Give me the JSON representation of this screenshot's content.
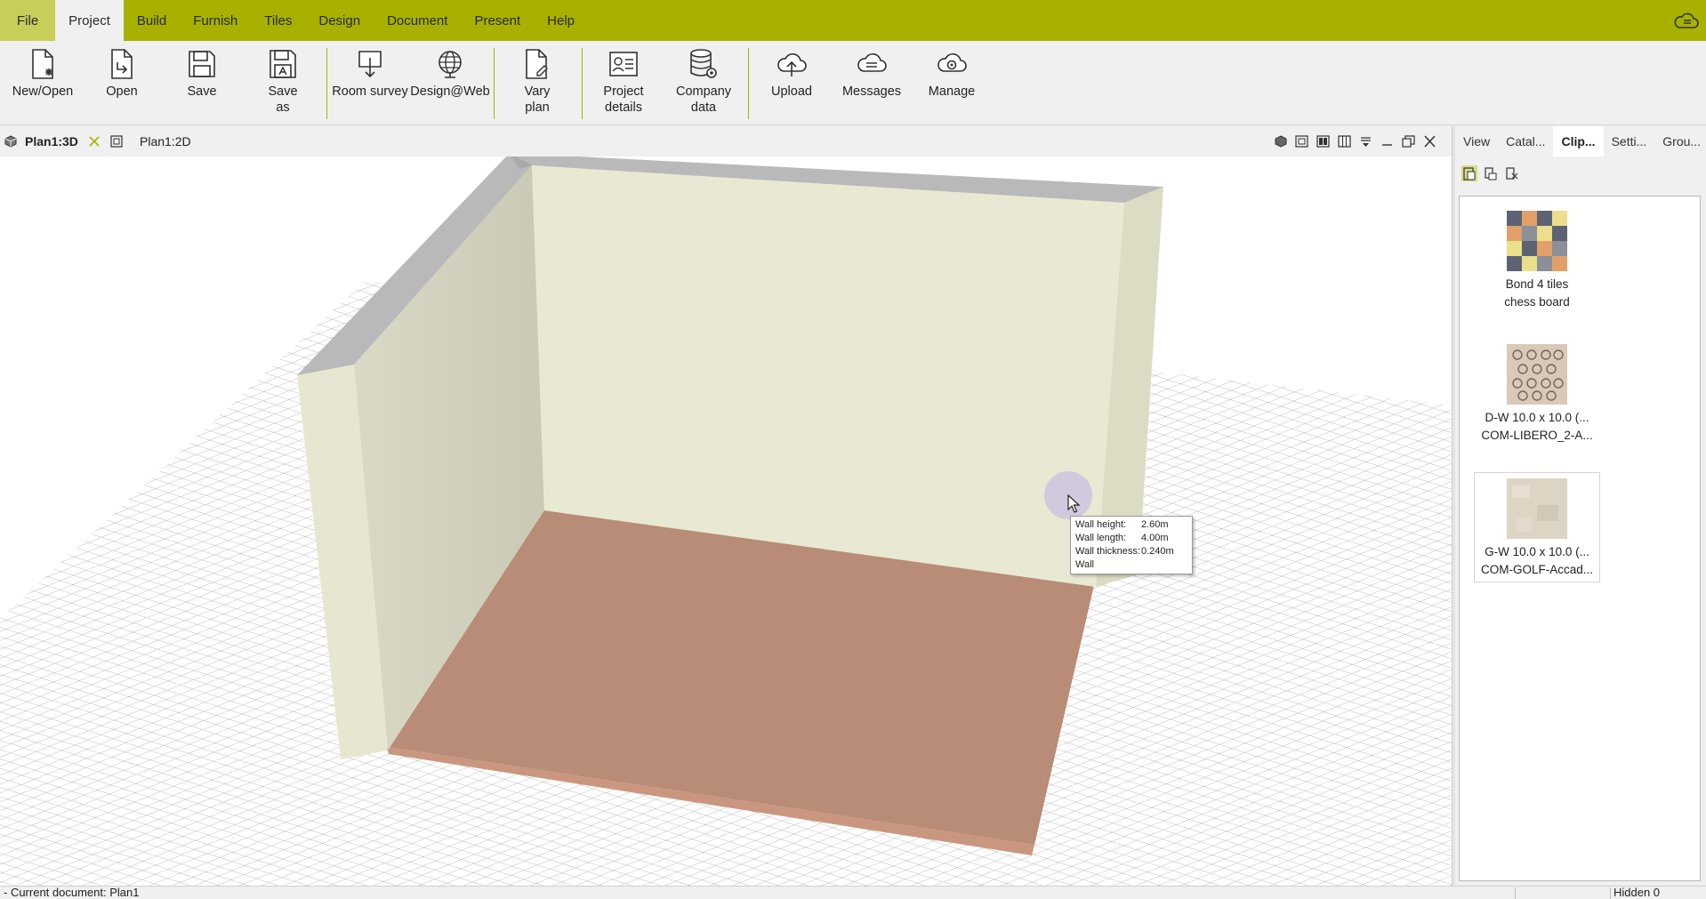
{
  "menu": {
    "items": [
      {
        "label": "File"
      },
      {
        "label": "Project"
      },
      {
        "label": "Build"
      },
      {
        "label": "Furnish"
      },
      {
        "label": "Tiles"
      },
      {
        "label": "Design"
      },
      {
        "label": "Document"
      },
      {
        "label": "Present"
      },
      {
        "label": "Help"
      }
    ],
    "active": "Project"
  },
  "ribbon": {
    "new_open": "New/Open",
    "open": "Open",
    "save": "Save",
    "save_as": "Save\nas",
    "room_survey": "Room survey",
    "design_web": "Design@Web",
    "vary_plan": "Vary\nplan",
    "project_details": "Project\ndetails",
    "company_data": "Company\ndata",
    "upload": "Upload",
    "messages": "Messages",
    "manage": "Manage"
  },
  "doc_tabs": {
    "tab_3d": "Plan1:3D",
    "tab_2d": "Plan1:2D"
  },
  "tooltip": {
    "wall_height_label": "Wall height:",
    "wall_height_value": "2.60m",
    "wall_length_label": "Wall length:",
    "wall_length_value": "4.00m",
    "wall_thickness_label": "Wall thickness:",
    "wall_thickness_value": "0.240m",
    "type": "Wall"
  },
  "right_panel": {
    "tabs": [
      "View",
      "Catal...",
      "Clip...",
      "Setti...",
      "Grou..."
    ],
    "active_tab": "Clip...",
    "clips": [
      {
        "line1": "Bond 4 tiles",
        "line2": "chess board"
      },
      {
        "line1": "D-W 10.0 x 10.0 (...",
        "line2": "COM-LIBERO_2-A..."
      },
      {
        "line1": "G-W 10.0 x 10.0 (...",
        "line2": "COM-GOLF-Accad..."
      }
    ]
  },
  "status": {
    "left": "- Current document: Plan1",
    "right": "Hidden 0"
  },
  "colors": {
    "menubar": "#a8b000",
    "floor": "#b88c76",
    "wall": "#e9e9d3"
  }
}
